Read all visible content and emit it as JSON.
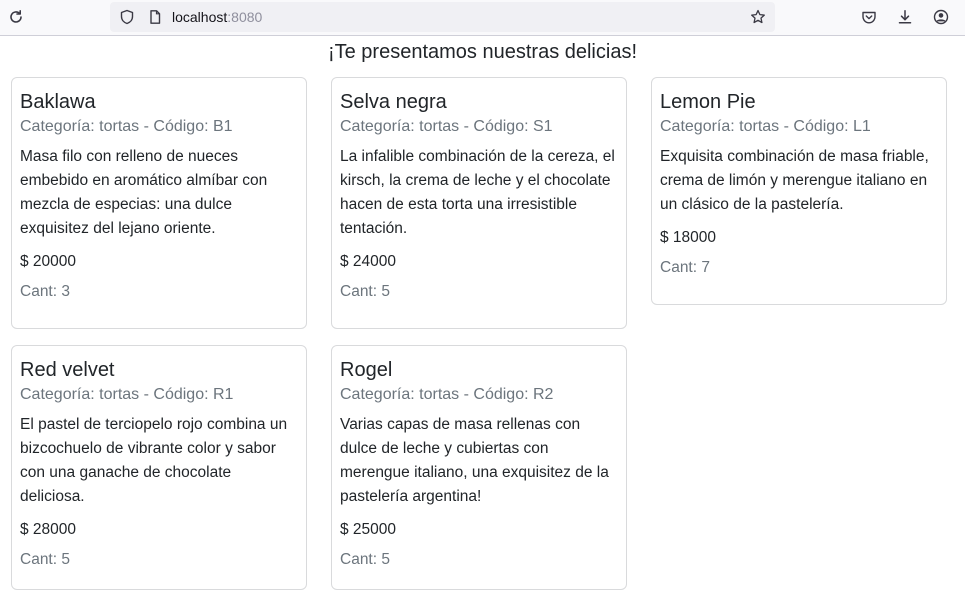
{
  "browser": {
    "url_host": "localhost",
    "url_port": ":8080"
  },
  "page": {
    "heading": "¡Te presentamos nuestras delicias!"
  },
  "products": [
    {
      "name": "Baklawa",
      "subtitle": "Categoría: tortas - Código: B1",
      "description": "Masa filo con relleno de nueces embebido en aromático almíbar con mezcla de especias: una dulce exquisitez del lejano oriente.",
      "price": "$ 20000",
      "quantity": "Cant: 3"
    },
    {
      "name": "Selva negra",
      "subtitle": "Categoría: tortas - Código: S1",
      "description": "La infalible combinación de la cereza, el kirsch, la crema de leche y el chocolate hacen de esta torta una irresistible tentación.",
      "price": "$ 24000",
      "quantity": "Cant: 5"
    },
    {
      "name": "Lemon Pie",
      "subtitle": "Categoría: tortas - Código: L1",
      "description": "Exquisita combinación de masa friable, crema de limón y merengue italiano en un clásico de la pastelería.",
      "price": "$ 18000",
      "quantity": "Cant: 7"
    },
    {
      "name": "Red velvet",
      "subtitle": "Categoría: tortas - Código: R1",
      "description": "El pastel de terciopelo rojo combina un bizcochuelo de vibrante color y sabor con una ganache de chocolate deliciosa.",
      "price": "$ 28000",
      "quantity": "Cant: 5"
    },
    {
      "name": "Rogel",
      "subtitle": "Categoría: tortas - Código: R2",
      "description": "Varias capas de masa rellenas con dulce de leche y cubiertas con merengue italiano, una exquisitez de la pastelería argentina!",
      "price": "$ 25000",
      "quantity": "Cant: 5"
    }
  ],
  "icons": {
    "reload": "reload-icon",
    "shield": "shield-icon",
    "page": "page-icon",
    "star": "star-icon",
    "pocket": "pocket-icon",
    "download": "download-icon",
    "account": "account-icon"
  }
}
